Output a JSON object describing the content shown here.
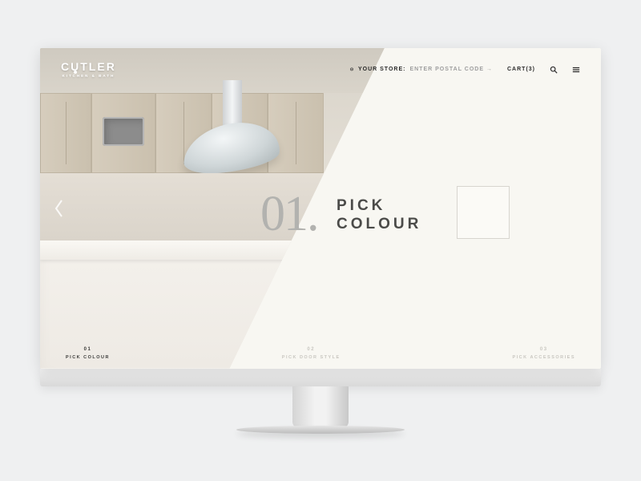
{
  "brand": {
    "name": "CUTLER",
    "tagline": "KITCHEN & BATH"
  },
  "header": {
    "store_label": "YOUR STORE:",
    "postal_placeholder": "ENTER POSTAL CODE",
    "cart_label": "CART(3)"
  },
  "step": {
    "number": "01.",
    "title": "PICK\nCOLOUR"
  },
  "progress": {
    "items": [
      {
        "num": "01",
        "label": "PICK COLOUR",
        "active": true
      },
      {
        "num": "02",
        "label": "PICK DOOR STYLE",
        "active": false
      },
      {
        "num": "03",
        "label": "PICK ACCESSORIES",
        "active": false
      }
    ]
  }
}
